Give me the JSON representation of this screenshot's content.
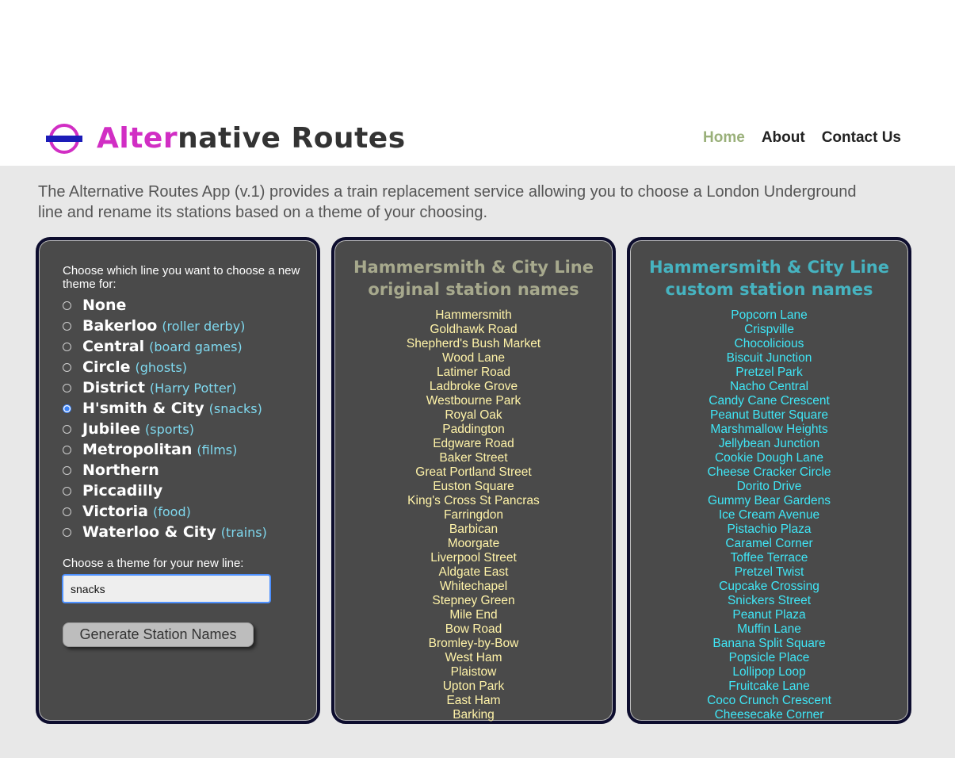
{
  "header": {
    "logo_accent": "Alter",
    "logo_rest": "native Routes",
    "nav": [
      "Home",
      "About",
      "Contact Us"
    ]
  },
  "intro": "The Alternative Routes App (v.1) provides a train replacement service allowing you to choose a London Underground line and rename its stations based on a theme of your choosing.",
  "form": {
    "prompt": "Choose which line you want to choose a new theme for:",
    "lines": [
      {
        "name": "None",
        "theme": ""
      },
      {
        "name": "Bakerloo",
        "theme": "(roller derby)"
      },
      {
        "name": "Central",
        "theme": "(board games)"
      },
      {
        "name": "Circle",
        "theme": "(ghosts)"
      },
      {
        "name": "District",
        "theme": "(Harry Potter)"
      },
      {
        "name": "H'smith & City",
        "theme": "(snacks)"
      },
      {
        "name": "Jubilee",
        "theme": "(sports)"
      },
      {
        "name": "Metropolitan",
        "theme": "(films)"
      },
      {
        "name": "Northern",
        "theme": ""
      },
      {
        "name": "Piccadilly",
        "theme": ""
      },
      {
        "name": "Victoria",
        "theme": "(food)"
      },
      {
        "name": "Waterloo & City",
        "theme": "(trains)"
      }
    ],
    "selected_index": 5,
    "theme_label": "Choose a theme for your new line:",
    "theme_value": "snacks",
    "button_label": "Generate Station Names"
  },
  "original": {
    "title_line1": "Hammersmith & City Line",
    "title_line2": "original station names",
    "stations": [
      "Hammersmith",
      "Goldhawk Road",
      "Shepherd's Bush Market",
      "Wood Lane",
      "Latimer Road",
      "Ladbroke Grove",
      "Westbourne Park",
      "Royal Oak",
      "Paddington",
      "Edgware Road",
      "Baker Street",
      "Great Portland Street",
      "Euston Square",
      "King's Cross St Pancras",
      "Farringdon",
      "Barbican",
      "Moorgate",
      "Liverpool Street",
      "Aldgate East",
      "Whitechapel",
      "Stepney Green",
      "Mile End",
      "Bow Road",
      "Bromley-by-Bow",
      "West Ham",
      "Plaistow",
      "Upton Park",
      "East Ham",
      "Barking"
    ]
  },
  "custom": {
    "title_line1": "Hammersmith & City Line",
    "title_line2": "custom station names",
    "stations": [
      "Popcorn Lane",
      "Crispville",
      "Chocolicious",
      "Biscuit Junction",
      "Pretzel Park",
      "Nacho Central",
      "Candy Cane Crescent",
      "Peanut Butter Square",
      "Marshmallow Heights",
      "Jellybean Junction",
      "Cookie Dough Lane",
      "Cheese Cracker Circle",
      "Dorito Drive",
      "Gummy Bear Gardens",
      "Ice Cream Avenue",
      "Pistachio Plaza",
      "Caramel Corner",
      "Toffee Terrace",
      "Pretzel Twist",
      "Cupcake Crossing",
      "Snickers Street",
      "Peanut Plaza",
      "Muffin Lane",
      "Banana Split Square",
      "Popsicle Place",
      "Lollipop Loop",
      "Fruitcake Lane",
      "Coco Crunch Crescent",
      "Cheesecake Corner"
    ]
  }
}
